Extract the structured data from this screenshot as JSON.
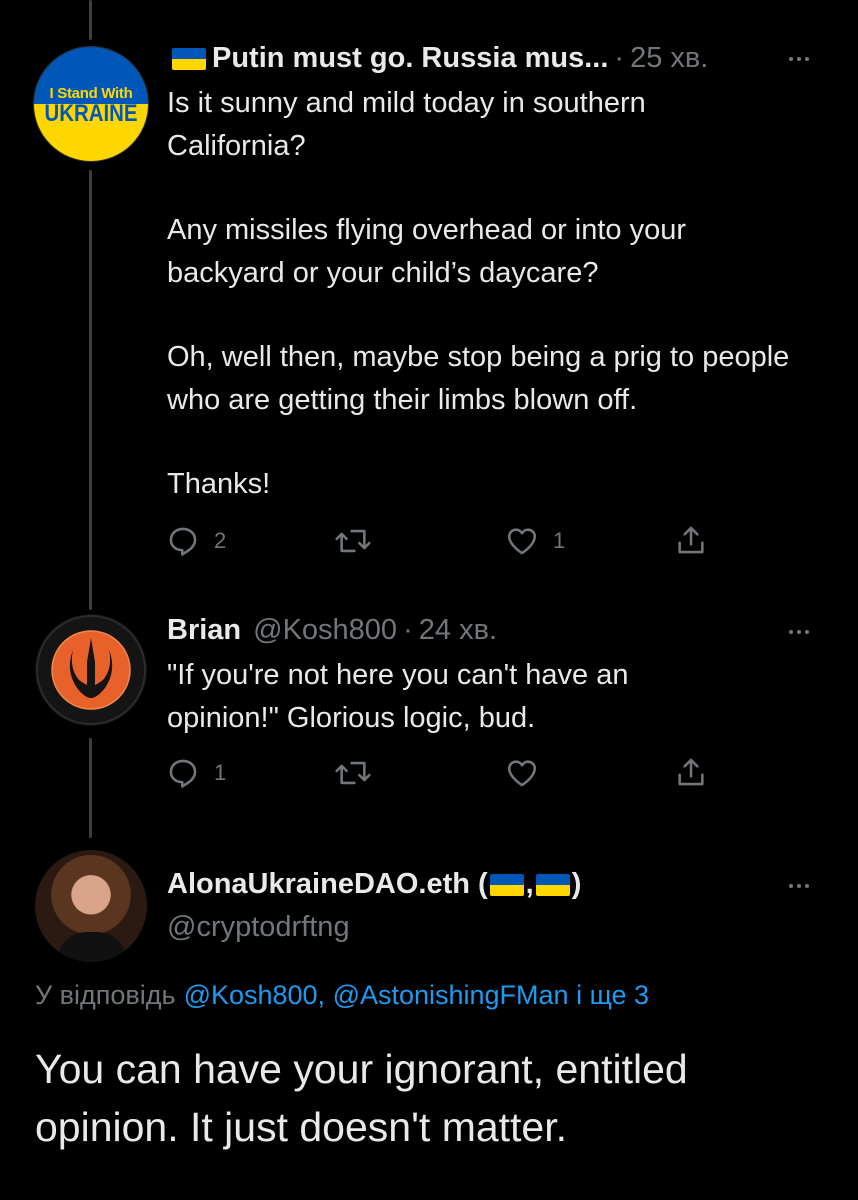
{
  "thread": [
    {
      "author_name": "Putin must go. Russia mus...",
      "time": "25 хв.",
      "avatar": {
        "line1": "I Stand With",
        "line2": "UKRAINE"
      },
      "text": [
        "Is it sunny and mild today in southern California?",
        "Any missiles flying overhead or into your backyard or your child’s daycare?",
        "Oh, well then, maybe stop being a prig to people who are getting their limbs blown off.",
        "Thanks!"
      ],
      "stats": {
        "replies": "2",
        "retweets": "",
        "likes": "1"
      }
    },
    {
      "author_name": "Brian",
      "handle": "@Kosh800",
      "time": "24 хв.",
      "avatar_icon": "rebel-alliance-icon",
      "text": "\"If you're not here you can't have an opinion!\" Glorious logic, bud.",
      "stats": {
        "replies": "1",
        "retweets": "",
        "likes": ""
      }
    }
  ],
  "focused": {
    "author_name": "AlonaUkraineDAO.eth (",
    "name_sep": ",",
    "name_end": ")",
    "handle": "@cryptodrftng",
    "reply_prefix": "У відповідь",
    "reply_mentions": "@Kosh800, @AstonishingFMan і ще 3",
    "text": "You can have your ignorant, entitled opinion. It just doesn't matter."
  },
  "colors": {
    "background": "#000000",
    "text": "#e7e9ea",
    "muted": "#71767b",
    "link": "#1d9bf0",
    "flag_blue": "#0057b7",
    "flag_yellow": "#ffd700",
    "rebel_orange": "#e8612a"
  }
}
